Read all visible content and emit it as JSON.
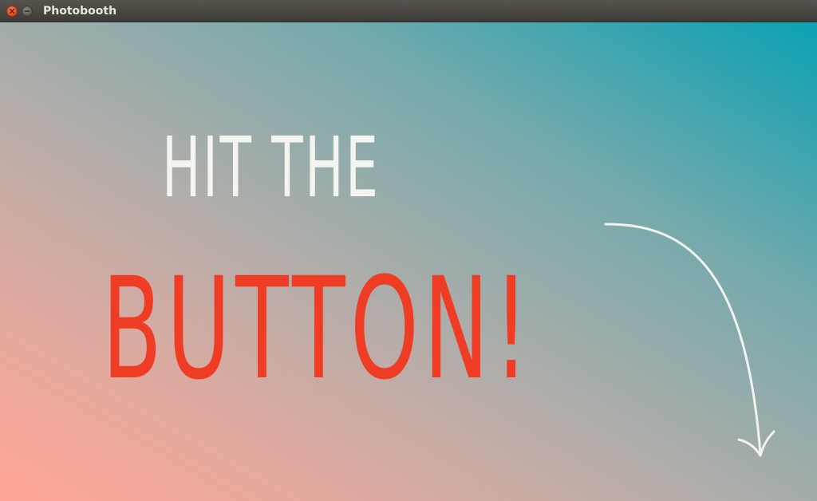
{
  "window": {
    "title": "Photobooth",
    "close_icon": "close-icon",
    "minimize_icon": "minimize-icon",
    "close_color": "#e8501f",
    "minimize_color": "#6c6a65"
  },
  "main": {
    "headline_top": "HIT THE",
    "headline_main": "BUTTON!",
    "headline_top_color": "#f4f4f1",
    "headline_main_color": "#ef3d25",
    "arrow_icon": "curved-arrow-down-icon",
    "gradient_colors": [
      "#ffa495",
      "#aeadaa",
      "#0aa1b3"
    ]
  }
}
